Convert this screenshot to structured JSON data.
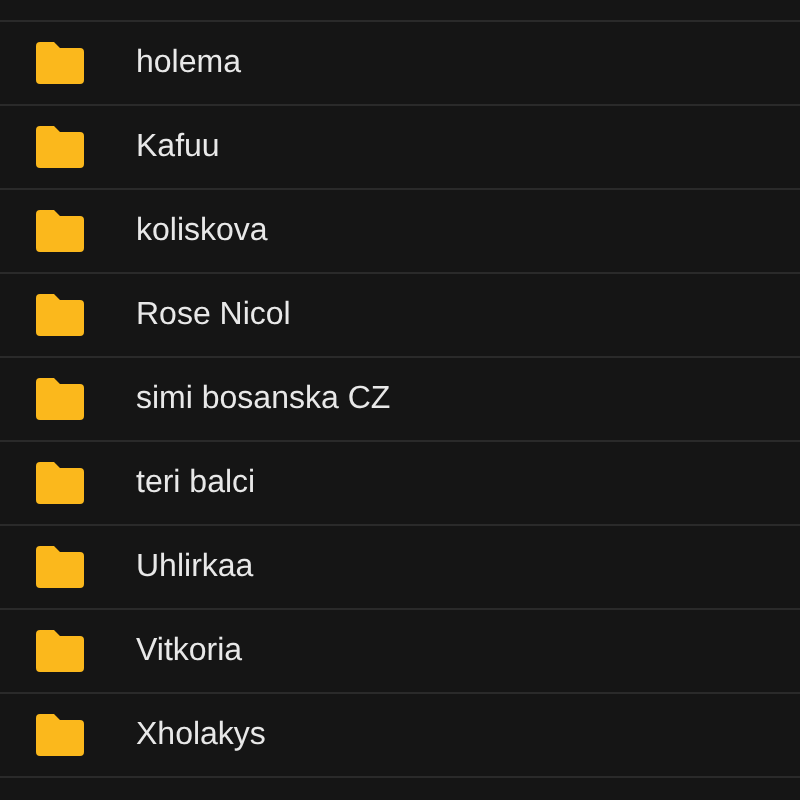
{
  "folders": [
    {
      "name": "holema"
    },
    {
      "name": "Kafuu"
    },
    {
      "name": "koliskova"
    },
    {
      "name": "Rose Nicol"
    },
    {
      "name": "simi bosanska CZ"
    },
    {
      "name": "teri balci"
    },
    {
      "name": "Uhlirkaa"
    },
    {
      "name": "Vitkoria"
    },
    {
      "name": "Xholakys"
    }
  ]
}
